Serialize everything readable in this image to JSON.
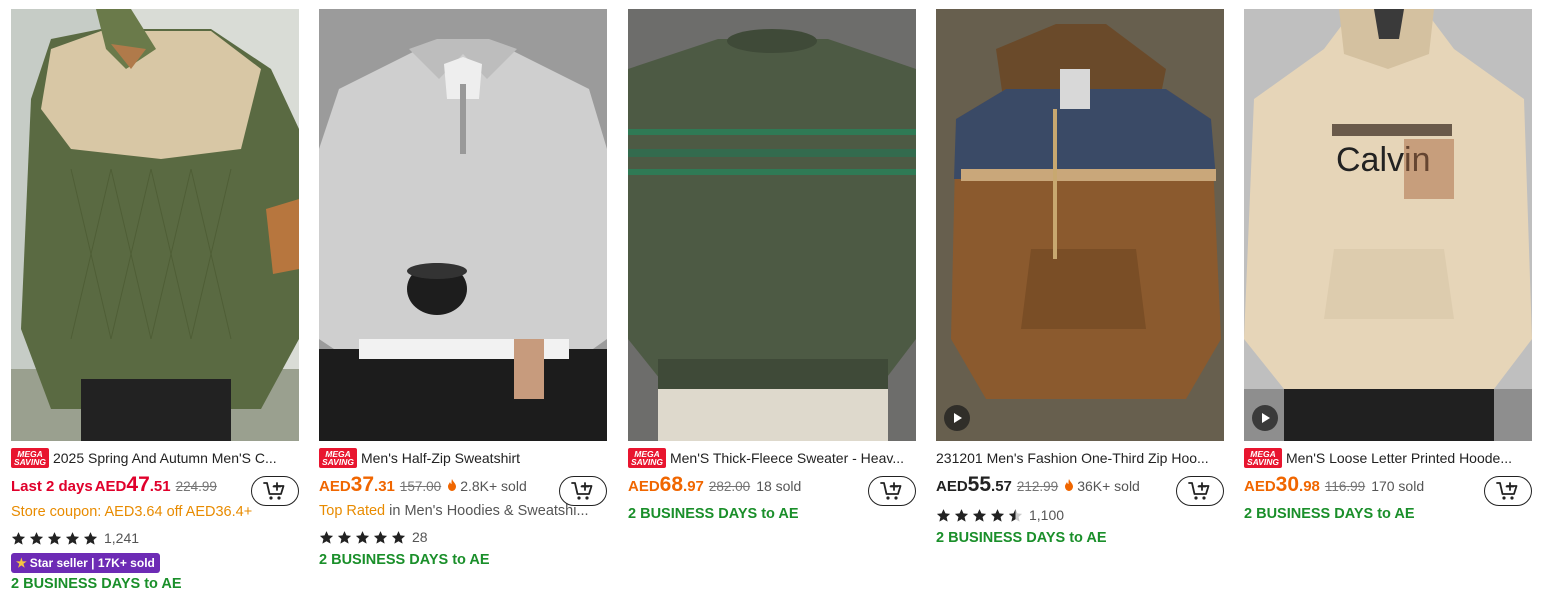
{
  "mega_badge": {
    "line1": "MEGA",
    "line2": "SAVING"
  },
  "products": [
    {
      "title": "2025 Spring And Autumn Men'S C...",
      "promo": "Last 2 days",
      "currency": "AED",
      "price_main": "47",
      "price_cents": ".51",
      "original_price": "224.99",
      "coupon": "Store coupon: AED3.64 off AED36.4+",
      "rating": "1,241",
      "seller_badge": "Star seller | 17K+ sold",
      "shipping": "2 BUSINESS DAYS to AE"
    },
    {
      "title": "Men's Half-Zip Sweatshirt",
      "currency": "AED",
      "price_main": "37",
      "price_cents": ".31",
      "original_price": "157.00",
      "sold": "2.8K+ sold",
      "top_rated": "Top Rated",
      "top_rated_rest": " in Men's Hoodies & Sweatshi...",
      "rating": "28",
      "shipping": "2 BUSINESS DAYS to AE"
    },
    {
      "title": "Men'S Thick-Fleece Sweater - Heav...",
      "currency": "AED",
      "price_main": "68",
      "price_cents": ".97",
      "original_price": "282.00",
      "sold": "18 sold",
      "shipping": "2 BUSINESS DAYS to AE"
    },
    {
      "title": "231201 Men's Fashion One-Third Zip Hoo...",
      "currency": "AED",
      "price_main": "55",
      "price_cents": ".57",
      "original_price": "212.99",
      "sold": "36K+ sold",
      "rating": "1,100",
      "shipping": "2 BUSINESS DAYS to AE"
    },
    {
      "title": "Men'S Loose Letter Printed Hoode...",
      "currency": "AED",
      "price_main": "30",
      "price_cents": ".98",
      "original_price": "116.99",
      "sold": "170 sold",
      "shipping": "2 BUSINESS DAYS to AE"
    }
  ],
  "hoodie_print": "Calvin",
  "icons": {
    "cart": "add-to-cart-icon",
    "star": "star-icon",
    "flame": "flame-icon",
    "play": "play-icon"
  },
  "colors": {
    "accent_red": "#e0002b",
    "price_orange": "#f06600",
    "coupon_orange": "#e88b00",
    "shipping_green": "#1a8f2a",
    "seller_purple": "#6d2bb5"
  }
}
